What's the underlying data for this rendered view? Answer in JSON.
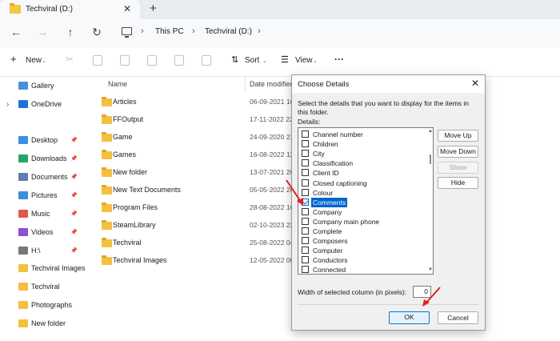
{
  "tab": {
    "title": "Techviral (D:)",
    "close": "✕",
    "add": "+"
  },
  "address": {
    "crumbs": [
      "This PC",
      "Techviral (D:)"
    ]
  },
  "toolbar": {
    "new_label": "New",
    "sort_label": "Sort",
    "view_label": "View",
    "more": "···"
  },
  "sidebar": {
    "items": [
      {
        "label": "Gallery",
        "icon": "gallery-icon",
        "color": "#4a90d9",
        "pin": false,
        "chev": false
      },
      {
        "label": "OneDrive",
        "icon": "cloud-icon",
        "color": "#1e73d2",
        "pin": false,
        "chev": true
      },
      {
        "label": "Desktop",
        "icon": "desktop-icon",
        "color": "#3a8ee6",
        "pin": true,
        "chev": false
      },
      {
        "label": "Downloads",
        "icon": "download-icon",
        "color": "#2aa36b",
        "pin": true,
        "chev": false
      },
      {
        "label": "Documents",
        "icon": "document-icon",
        "color": "#5b7fb5",
        "pin": true,
        "chev": false
      },
      {
        "label": "Pictures",
        "icon": "picture-icon",
        "color": "#3d8fd8",
        "pin": true,
        "chev": false
      },
      {
        "label": "Music",
        "icon": "music-icon",
        "color": "#e1574a",
        "pin": true,
        "chev": false
      },
      {
        "label": "Videos",
        "icon": "video-icon",
        "color": "#8a4fd4",
        "pin": true,
        "chev": false
      },
      {
        "label": "H:\\",
        "icon": "drive-icon",
        "color": "#777777",
        "pin": true,
        "chev": false
      },
      {
        "label": "Techviral Images",
        "icon": "folder-icon",
        "color": "#f3c03f",
        "pin": false,
        "chev": false
      },
      {
        "label": "Techviral",
        "icon": "folder-icon",
        "color": "#f3c03f",
        "pin": false,
        "chev": false
      },
      {
        "label": "Photographs",
        "icon": "folder-icon",
        "color": "#f3c03f",
        "pin": false,
        "chev": false
      },
      {
        "label": "New folder",
        "icon": "folder-icon",
        "color": "#f3c03f",
        "pin": false,
        "chev": false
      }
    ]
  },
  "files": {
    "col_name": "Name",
    "col_date": "Date modified",
    "rows": [
      {
        "name": "Articles",
        "date": "06-09-2021 16:"
      },
      {
        "name": "FFOutput",
        "date": "17-11-2022 22:"
      },
      {
        "name": "Game",
        "date": "24-09-2020 21:"
      },
      {
        "name": "Games",
        "date": "16-08-2022 12:"
      },
      {
        "name": "New folder",
        "date": "13-07-2021 20:"
      },
      {
        "name": "New Text Documents",
        "date": "05-05-2022 20:"
      },
      {
        "name": "Program Files",
        "date": "28-08-2022 16:"
      },
      {
        "name": "SteamLibrary",
        "date": "02-10-2023 23:"
      },
      {
        "name": "Techviral",
        "date": "25-08-2022 04:"
      },
      {
        "name": "Techviral Images",
        "date": "12-05-2022 00:"
      }
    ]
  },
  "dialog": {
    "title": "Choose Details",
    "close": "✕",
    "description": "Select the details that you want to display for the items in this folder.",
    "details_label": "Details:",
    "items": [
      {
        "label": "Channel number",
        "checked": false,
        "selected": false
      },
      {
        "label": "Children",
        "checked": false,
        "selected": false
      },
      {
        "label": "City",
        "checked": false,
        "selected": false
      },
      {
        "label": "Classification",
        "checked": false,
        "selected": false
      },
      {
        "label": "Client ID",
        "checked": false,
        "selected": false
      },
      {
        "label": "Closed captioning",
        "checked": false,
        "selected": false
      },
      {
        "label": "Colour",
        "checked": false,
        "selected": false
      },
      {
        "label": "Comments",
        "checked": true,
        "selected": true
      },
      {
        "label": "Company",
        "checked": false,
        "selected": false
      },
      {
        "label": "Company main phone",
        "checked": false,
        "selected": false
      },
      {
        "label": "Complete",
        "checked": false,
        "selected": false
      },
      {
        "label": "Composers",
        "checked": false,
        "selected": false
      },
      {
        "label": "Computer",
        "checked": false,
        "selected": false
      },
      {
        "label": "Conductors",
        "checked": false,
        "selected": false
      },
      {
        "label": "Connected",
        "checked": false,
        "selected": false
      }
    ],
    "move_up": "Move Up",
    "move_down": "Move Down",
    "show": "Show",
    "hide": "Hide",
    "width_label": "Width of selected column (in pixels):",
    "width_value": "0",
    "ok": "OK",
    "cancel": "Cancel"
  },
  "colors": {
    "accent": "#0063d1",
    "annotation": "#e02020"
  }
}
